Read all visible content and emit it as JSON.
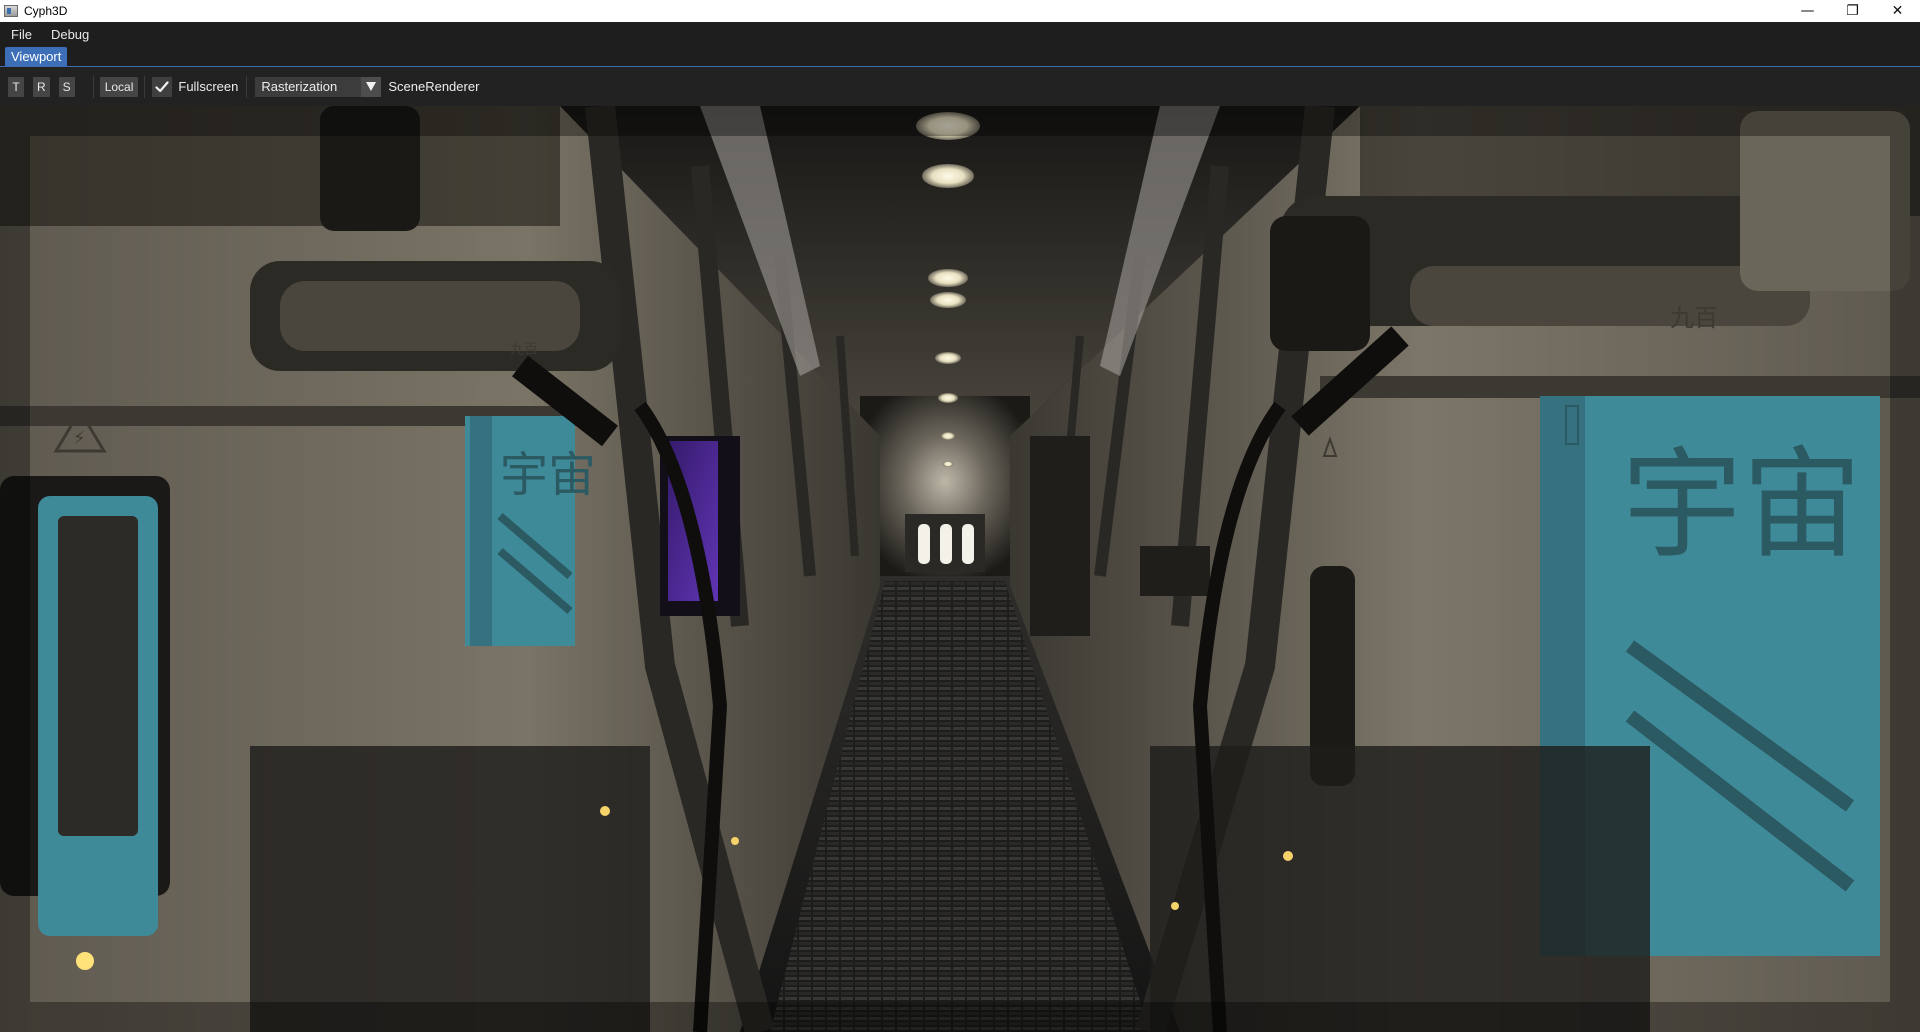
{
  "window": {
    "title": "Cyph3D",
    "controls": {
      "minimize": "—",
      "maximize": "❐",
      "close": "✕"
    }
  },
  "menu": {
    "items": [
      "File",
      "Debug"
    ]
  },
  "tabs": [
    {
      "label": "Viewport",
      "active": true
    }
  ],
  "toolbar": {
    "translate_label": "T",
    "rotate_label": "R",
    "scale_label": "S",
    "space_label": "Local",
    "fullscreen": {
      "label": "Fullscreen",
      "checked": true
    },
    "render_mode": {
      "selected": "Rasterization"
    },
    "renderer_label": "SceneRenderer"
  },
  "viewport": {
    "scene": "sci-fi-corridor",
    "wall_text_left_large": "宇宙",
    "wall_text_right_large": "宇宙",
    "wall_text_small_right": "九百",
    "wall_text_small_left": "九百",
    "accent_color": "#3f8a99"
  }
}
